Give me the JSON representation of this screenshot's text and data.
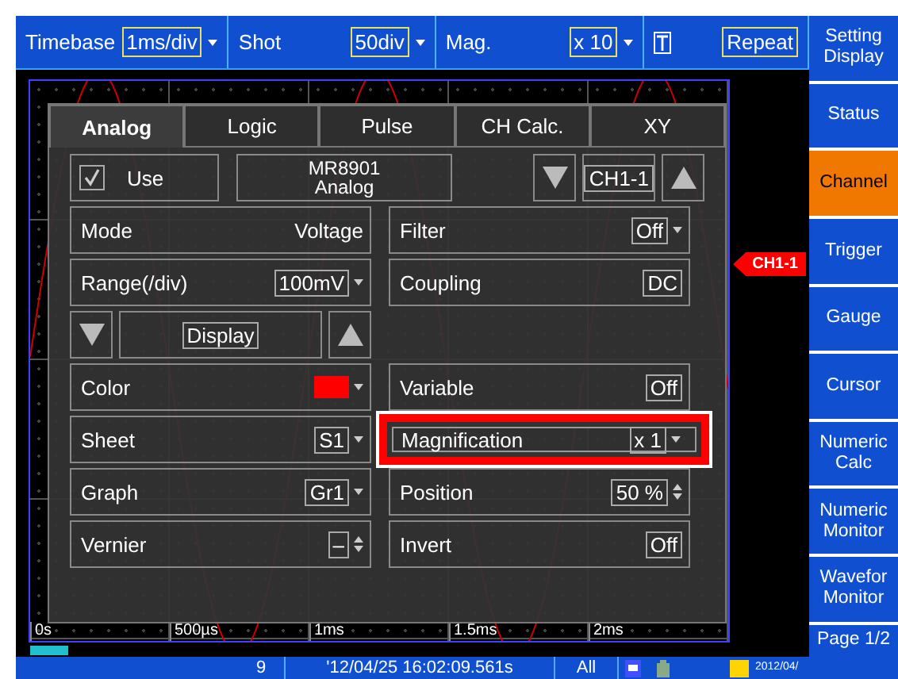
{
  "top_bar": [
    {
      "kind": "dropdown",
      "label": "Timebase",
      "value": "1ms/div"
    },
    {
      "kind": "dropdown",
      "label": "Shot",
      "value": "50div"
    },
    {
      "kind": "dropdown",
      "label": "Mag.",
      "value": "x 10"
    },
    {
      "kind": "trigger",
      "value": "Repeat"
    }
  ],
  "side_menu": [
    {
      "label": "Setting Display",
      "selected": false
    },
    {
      "label": "Status",
      "selected": false
    },
    {
      "label": "Channel",
      "selected": true
    },
    {
      "label": "Trigger",
      "selected": false
    },
    {
      "label": "Gauge",
      "selected": false
    },
    {
      "label": "Cursor",
      "selected": false
    },
    {
      "label": "Numeric Calc",
      "selected": false
    },
    {
      "label": "Numeric Monitor",
      "selected": false
    },
    {
      "label": "Wavefor Monitor",
      "selected": false
    },
    {
      "label": "Page 1/2",
      "selected": false
    }
  ],
  "graph": {
    "channel_marker": "CH1-1",
    "time_labels": [
      "0s",
      "500µs",
      "1ms",
      "1.5ms",
      "2ms"
    ]
  },
  "dialog": {
    "tabs": [
      {
        "label": "Analog",
        "selected": true
      },
      {
        "label": "Logic",
        "selected": false
      },
      {
        "label": "Pulse",
        "selected": false
      },
      {
        "label": "CH Calc.",
        "selected": false
      },
      {
        "label": "XY",
        "selected": false
      }
    ],
    "use": {
      "label": "Use",
      "checked": true
    },
    "module": "MR8901 Analog",
    "channel": "CH1-1",
    "rows": [
      {
        "left": {
          "kind": "text",
          "label": "Mode",
          "value": "Voltage",
          "highlighted": false
        },
        "right": {
          "kind": "dropdown",
          "label": "Filter",
          "value": "Off",
          "highlighted": false
        }
      },
      {
        "left": {
          "kind": "dropdown",
          "label": "Range(/div)",
          "value": "100mV",
          "highlighted": false
        },
        "right": {
          "kind": "toggle",
          "label": "Coupling",
          "value": "DC",
          "highlighted": false
        }
      },
      {
        "left": {
          "kind": "nav",
          "label": "Display",
          "highlighted": false
        }
      },
      {
        "left": {
          "kind": "color",
          "label": "Color",
          "color": "#ff0000",
          "highlighted": false
        },
        "right": {
          "kind": "toggle",
          "label": "Variable",
          "value": "Off",
          "highlighted": false
        }
      },
      {
        "left": {
          "kind": "dropdown",
          "label": "Sheet",
          "value": "S1",
          "highlighted": false
        },
        "right": {
          "kind": "dropdown",
          "label": "Magnification",
          "value": "x 1",
          "highlighted": true
        }
      },
      {
        "left": {
          "kind": "dropdown",
          "label": "Graph",
          "value": "Gr1",
          "highlighted": false
        },
        "right": {
          "kind": "spinner",
          "label": "Position",
          "value": "50 %",
          "highlighted": false
        }
      },
      {
        "left": {
          "kind": "spinner",
          "label": "Vernier",
          "value": "–",
          "highlighted": false
        },
        "right": {
          "kind": "toggle",
          "label": "Invert",
          "value": "Off",
          "highlighted": false
        }
      }
    ]
  },
  "status_bar": {
    "count": "9",
    "timestamp": "'12/04/25 16:02:09.561s",
    "range": "All",
    "clock": "2012/04/"
  }
}
